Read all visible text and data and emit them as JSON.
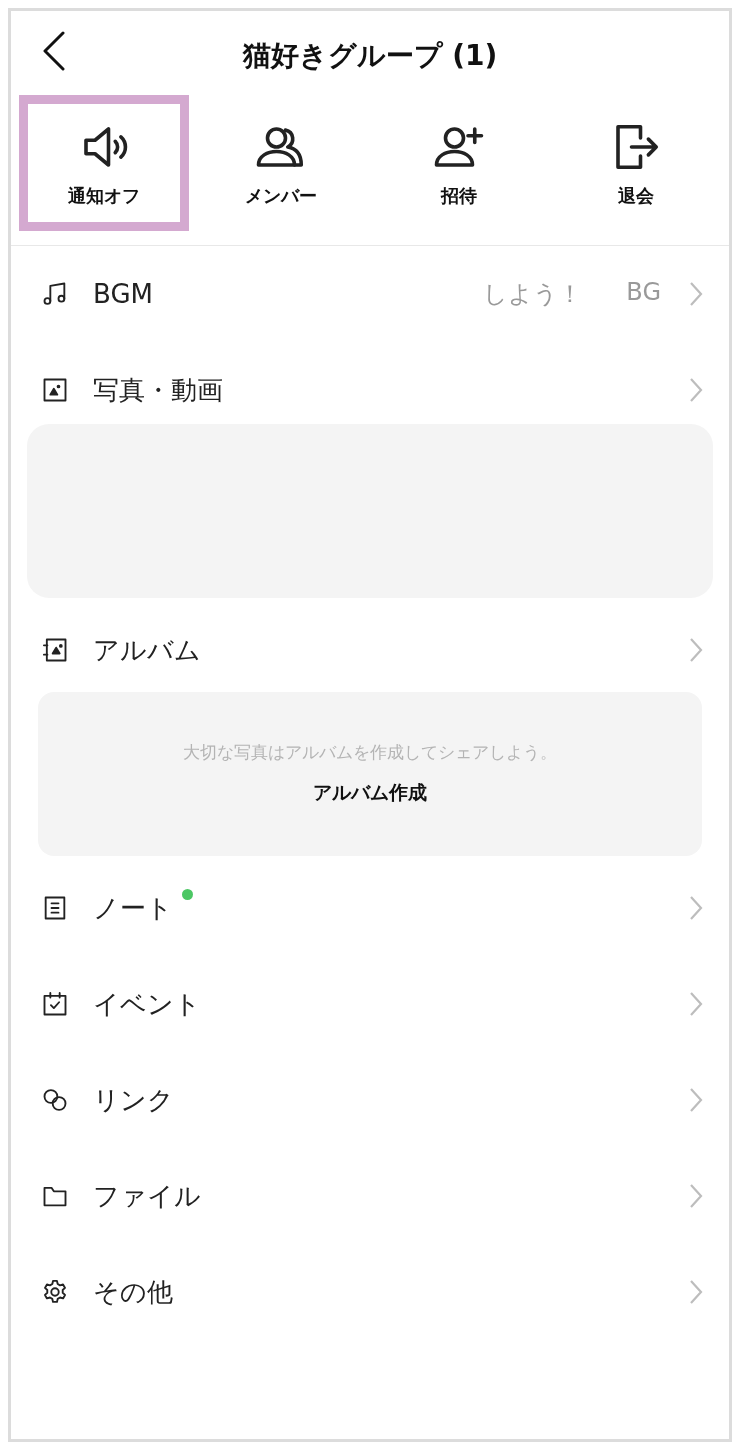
{
  "header": {
    "title": "猫好きグループ (1)"
  },
  "actions": [
    {
      "kind": "speaker",
      "label": "通知オフ",
      "highlighted": true
    },
    {
      "kind": "members",
      "label": "メンバー",
      "highlighted": false
    },
    {
      "kind": "invite",
      "label": "招待",
      "highlighted": false
    },
    {
      "kind": "leave",
      "label": "退会",
      "highlighted": false
    }
  ],
  "menu": [
    {
      "kind": "music",
      "label": "BGM",
      "marquee": [
        "しよう！",
        "BG"
      ],
      "has_update": false
    },
    {
      "kind": "photo",
      "label": "写真・動画",
      "has_update": false,
      "panel": {
        "kind": "empty"
      }
    },
    {
      "kind": "album",
      "label": "アルバム",
      "has_update": false,
      "panel": {
        "kind": "album",
        "message": "大切な写真はアルバムを作成してシェアしよう。",
        "action": "アルバム作成"
      }
    },
    {
      "kind": "note",
      "label": "ノート",
      "has_update": true
    },
    {
      "kind": "event",
      "label": "イベント",
      "has_update": false
    },
    {
      "kind": "link",
      "label": "リンク",
      "has_update": false
    },
    {
      "kind": "folder",
      "label": "ファイル",
      "has_update": false
    },
    {
      "kind": "gear",
      "label": "その他",
      "has_update": false
    }
  ]
}
